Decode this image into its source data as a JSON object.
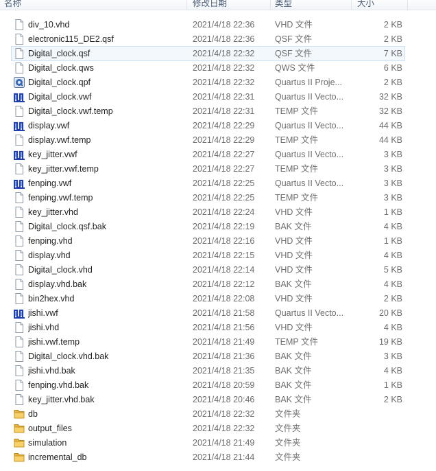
{
  "columns": {
    "name": "名称",
    "date": "修改日期",
    "type": "类型",
    "size": "大小"
  },
  "selected_index": 2,
  "files": [
    {
      "name": "div_10.vhd",
      "date": "2021/4/18 22:36",
      "type": "VHD 文件",
      "size": "2 KB",
      "icon": "document-icon"
    },
    {
      "name": "electronic115_DE2.qsf",
      "date": "2021/4/18 22:36",
      "type": "QSF 文件",
      "size": "2 KB",
      "icon": "document-icon"
    },
    {
      "name": "Digital_clock.qsf",
      "date": "2021/4/18 22:32",
      "type": "QSF 文件",
      "size": "7 KB",
      "icon": "document-icon"
    },
    {
      "name": "Digital_clock.qws",
      "date": "2021/4/18 22:32",
      "type": "QWS 文件",
      "size": "6 KB",
      "icon": "document-icon"
    },
    {
      "name": "Digital_clock.qpf",
      "date": "2021/4/18 22:32",
      "type": "Quartus II Proje...",
      "size": "2 KB",
      "icon": "quartus-project-icon"
    },
    {
      "name": "Digital_clock.vwf",
      "date": "2021/4/18 22:31",
      "type": "Quartus II Vecto...",
      "size": "32 KB",
      "icon": "waveform-icon"
    },
    {
      "name": "Digital_clock.vwf.temp",
      "date": "2021/4/18 22:31",
      "type": "TEMP 文件",
      "size": "32 KB",
      "icon": "document-icon"
    },
    {
      "name": "display.vwf",
      "date": "2021/4/18 22:29",
      "type": "Quartus II Vecto...",
      "size": "44 KB",
      "icon": "waveform-icon"
    },
    {
      "name": "display.vwf.temp",
      "date": "2021/4/18 22:29",
      "type": "TEMP 文件",
      "size": "44 KB",
      "icon": "document-icon"
    },
    {
      "name": "key_jitter.vwf",
      "date": "2021/4/18 22:27",
      "type": "Quartus II Vecto...",
      "size": "3 KB",
      "icon": "waveform-icon"
    },
    {
      "name": "key_jitter.vwf.temp",
      "date": "2021/4/18 22:27",
      "type": "TEMP 文件",
      "size": "3 KB",
      "icon": "document-icon"
    },
    {
      "name": "fenping.vwf",
      "date": "2021/4/18 22:25",
      "type": "Quartus II Vecto...",
      "size": "3 KB",
      "icon": "waveform-icon"
    },
    {
      "name": "fenping.vwf.temp",
      "date": "2021/4/18 22:25",
      "type": "TEMP 文件",
      "size": "3 KB",
      "icon": "document-icon"
    },
    {
      "name": "key_jitter.vhd",
      "date": "2021/4/18 22:24",
      "type": "VHD 文件",
      "size": "1 KB",
      "icon": "document-icon"
    },
    {
      "name": "Digital_clock.qsf.bak",
      "date": "2021/4/18 22:19",
      "type": "BAK 文件",
      "size": "4 KB",
      "icon": "document-icon"
    },
    {
      "name": "fenping.vhd",
      "date": "2021/4/18 22:16",
      "type": "VHD 文件",
      "size": "1 KB",
      "icon": "document-icon"
    },
    {
      "name": "display.vhd",
      "date": "2021/4/18 22:15",
      "type": "VHD 文件",
      "size": "4 KB",
      "icon": "document-icon"
    },
    {
      "name": "Digital_clock.vhd",
      "date": "2021/4/18 22:14",
      "type": "VHD 文件",
      "size": "5 KB",
      "icon": "document-icon"
    },
    {
      "name": "display.vhd.bak",
      "date": "2021/4/18 22:12",
      "type": "BAK 文件",
      "size": "4 KB",
      "icon": "document-icon"
    },
    {
      "name": "bin2hex.vhd",
      "date": "2021/4/18 22:08",
      "type": "VHD 文件",
      "size": "2 KB",
      "icon": "document-icon"
    },
    {
      "name": "jishi.vwf",
      "date": "2021/4/18 21:58",
      "type": "Quartus II Vecto...",
      "size": "20 KB",
      "icon": "waveform-icon"
    },
    {
      "name": "jishi.vhd",
      "date": "2021/4/18 21:56",
      "type": "VHD 文件",
      "size": "4 KB",
      "icon": "document-icon"
    },
    {
      "name": "jishi.vwf.temp",
      "date": "2021/4/18 21:49",
      "type": "TEMP 文件",
      "size": "19 KB",
      "icon": "document-icon"
    },
    {
      "name": "Digital_clock.vhd.bak",
      "date": "2021/4/18 21:36",
      "type": "BAK 文件",
      "size": "3 KB",
      "icon": "document-icon"
    },
    {
      "name": "jishi.vhd.bak",
      "date": "2021/4/18 21:35",
      "type": "BAK 文件",
      "size": "4 KB",
      "icon": "document-icon"
    },
    {
      "name": "fenping.vhd.bak",
      "date": "2021/4/18 20:59",
      "type": "BAK 文件",
      "size": "1 KB",
      "icon": "document-icon"
    },
    {
      "name": "key_jitter.vhd.bak",
      "date": "2021/4/18 20:46",
      "type": "BAK 文件",
      "size": "2 KB",
      "icon": "document-icon"
    },
    {
      "name": "db",
      "date": "2021/4/18 22:32",
      "type": "文件夹",
      "size": "",
      "icon": "folder-icon"
    },
    {
      "name": "output_files",
      "date": "2021/4/18 22:32",
      "type": "文件夹",
      "size": "",
      "icon": "folder-icon"
    },
    {
      "name": "simulation",
      "date": "2021/4/18 21:49",
      "type": "文件夹",
      "size": "",
      "icon": "folder-icon"
    },
    {
      "name": "incremental_db",
      "date": "2021/4/18 21:44",
      "type": "文件夹",
      "size": "",
      "icon": "folder-icon"
    }
  ]
}
